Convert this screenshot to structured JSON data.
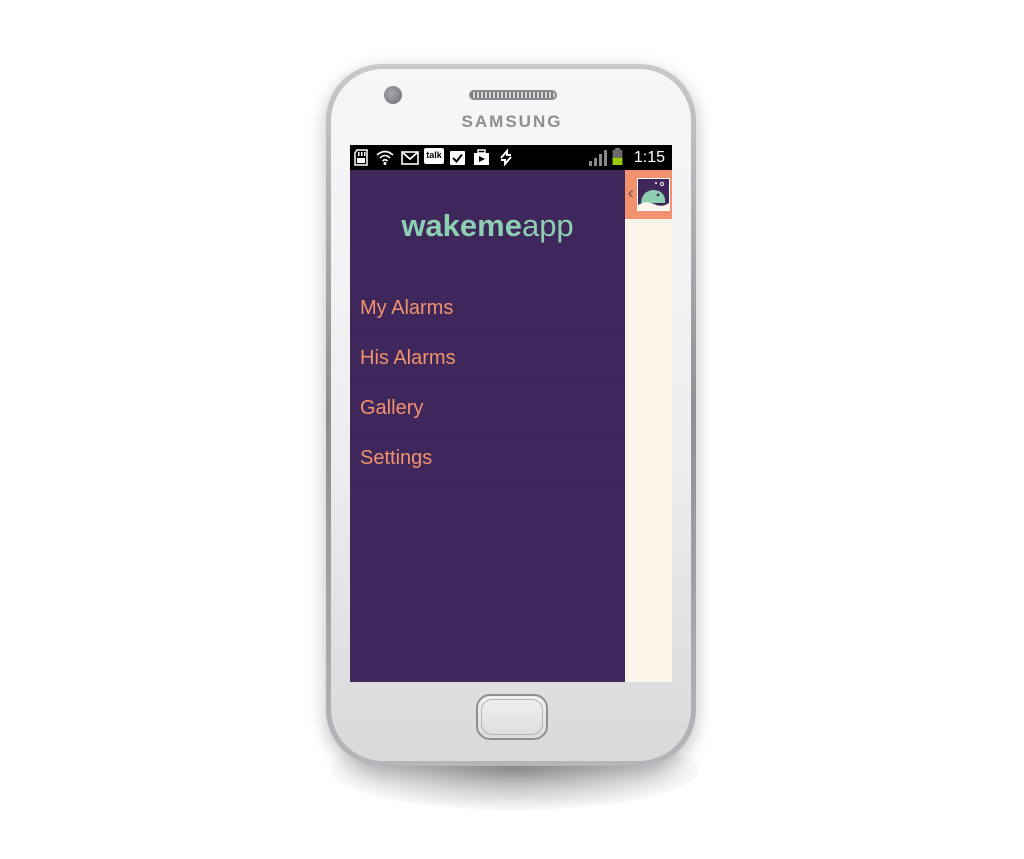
{
  "device": {
    "brand": "SAMSUNG"
  },
  "status_bar": {
    "time": "1:15",
    "notification_icons": [
      "sd-card-icon",
      "wifi-icon",
      "gmail-icon",
      "talk-icon",
      "tasks-check-icon",
      "play-store-icon",
      "sync-icon"
    ],
    "talk_label": "talk",
    "signal_icon": "signal-bars-icon",
    "battery_icon": "battery-icon"
  },
  "app": {
    "logo_bold": "wakeme",
    "logo_light": "app",
    "menu": [
      {
        "label": "My Alarms"
      },
      {
        "label": "His Alarms"
      },
      {
        "label": "Gallery"
      },
      {
        "label": "Settings"
      }
    ],
    "colors": {
      "drawer_bg": "#3f265b",
      "menu_text": "#f0926c",
      "logo": "#8ccfb1",
      "action_bar": "#f2916d",
      "content_bg": "#fdf5ea"
    }
  }
}
